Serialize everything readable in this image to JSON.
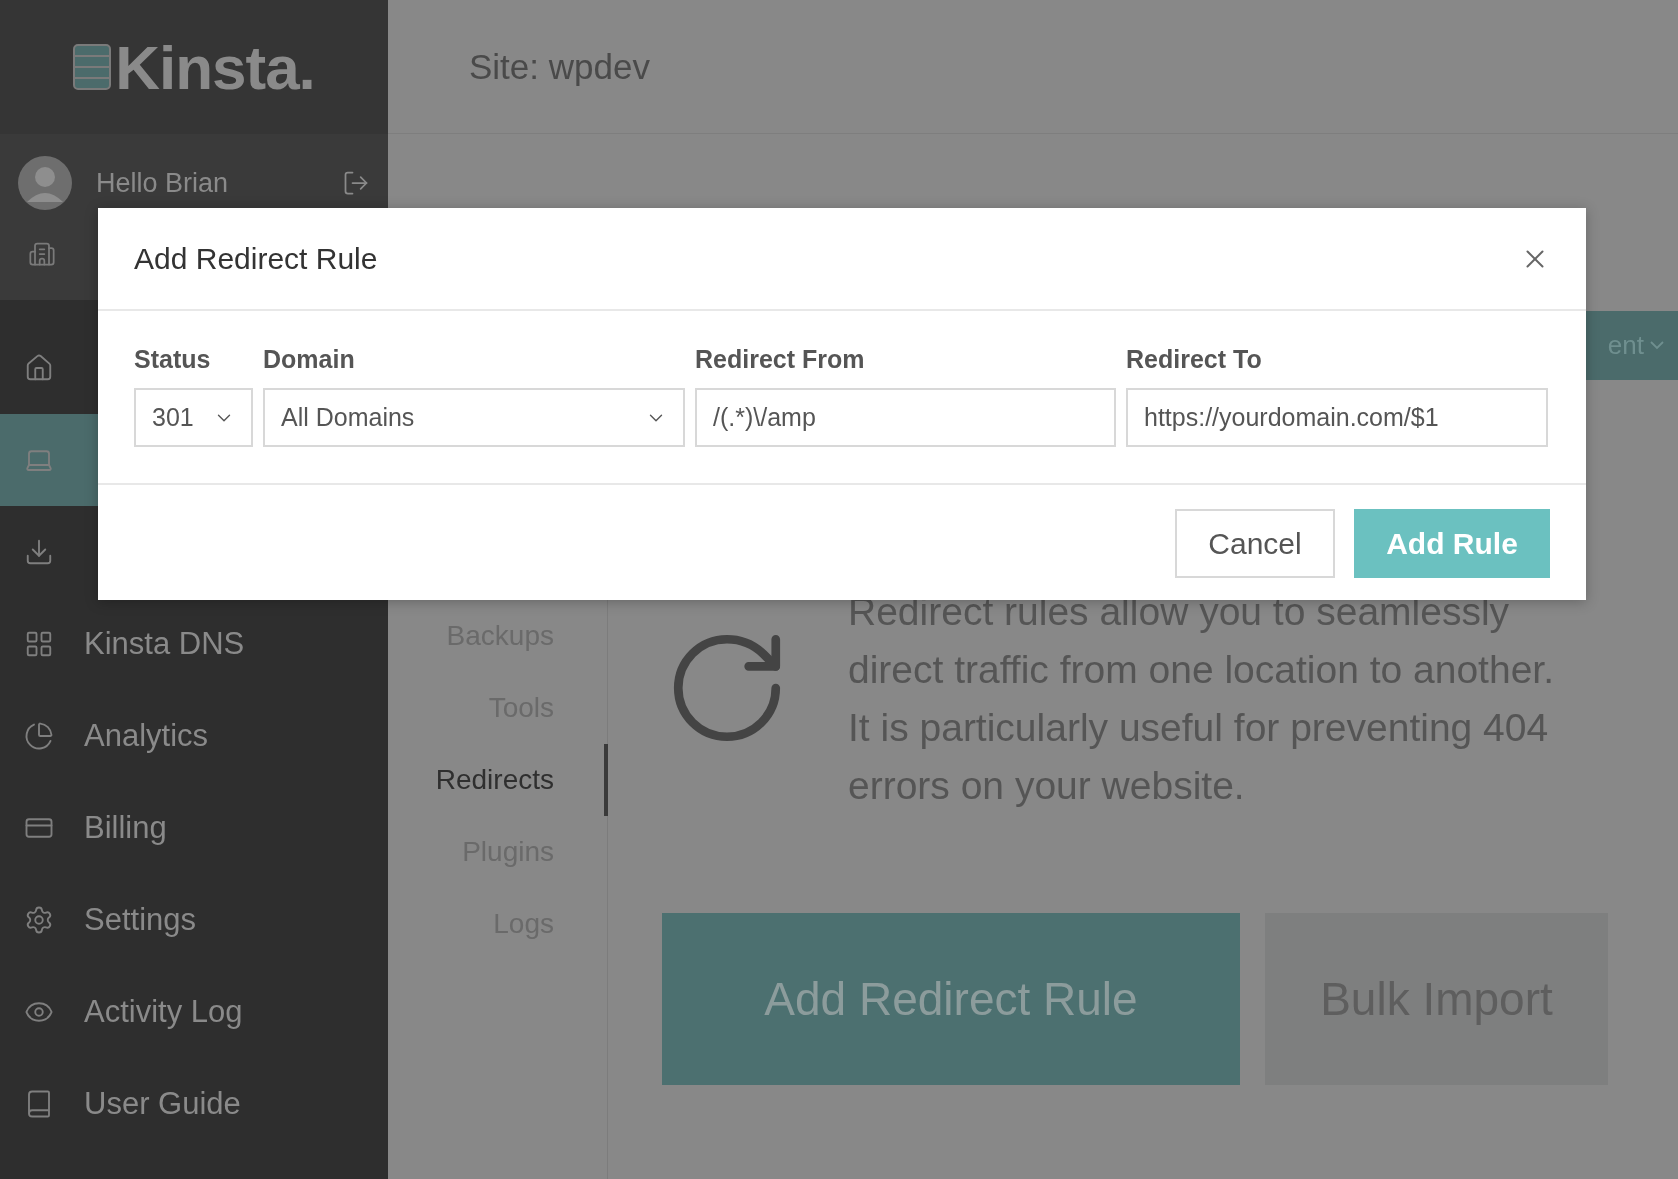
{
  "sidebar": {
    "logo": "Kinsta.",
    "user": {
      "greeting": "Hello Brian"
    },
    "nav": [
      {
        "selected": false
      },
      {
        "selected": true
      },
      {
        "selected": false
      },
      {
        "label": "Kinsta DNS",
        "selected": false
      },
      {
        "label": "Analytics",
        "selected": false
      },
      {
        "label": "Billing",
        "selected": false
      },
      {
        "label": "Settings",
        "selected": false
      },
      {
        "label": "Activity Log",
        "selected": false
      },
      {
        "label": "User Guide",
        "selected": false
      }
    ]
  },
  "header": {
    "title": "Site: wpdev"
  },
  "environment_button": {
    "label": "ent"
  },
  "subnav": [
    {
      "label": "Backups",
      "selected": false
    },
    {
      "label": "Tools",
      "selected": false
    },
    {
      "label": "Redirects",
      "selected": true
    },
    {
      "label": "Plugins",
      "selected": false
    },
    {
      "label": "Logs",
      "selected": false
    }
  ],
  "intro": {
    "text": "Redirect rules allow you to seamlessly direct traffic from one location to another. It is particularly useful for preventing 404 errors on your website."
  },
  "actions": [
    {
      "label": "Add Redirect Rule",
      "kind": "primary"
    },
    {
      "label": "Bulk Import",
      "kind": "secondary"
    }
  ],
  "modal": {
    "title": "Add Redirect Rule",
    "fields": [
      {
        "kind": "select",
        "label": "Status",
        "value": "301"
      },
      {
        "kind": "select",
        "label": "Domain",
        "value": "All Domains"
      },
      {
        "kind": "text",
        "label": "Redirect From",
        "value": "/(.*)\\/amp"
      },
      {
        "kind": "text",
        "label": "Redirect To",
        "value": "https://yourdomain.com/$1"
      }
    ],
    "buttons": [
      {
        "label": "Cancel",
        "kind": "secondary"
      },
      {
        "label": "Add Rule",
        "kind": "primary"
      }
    ]
  }
}
